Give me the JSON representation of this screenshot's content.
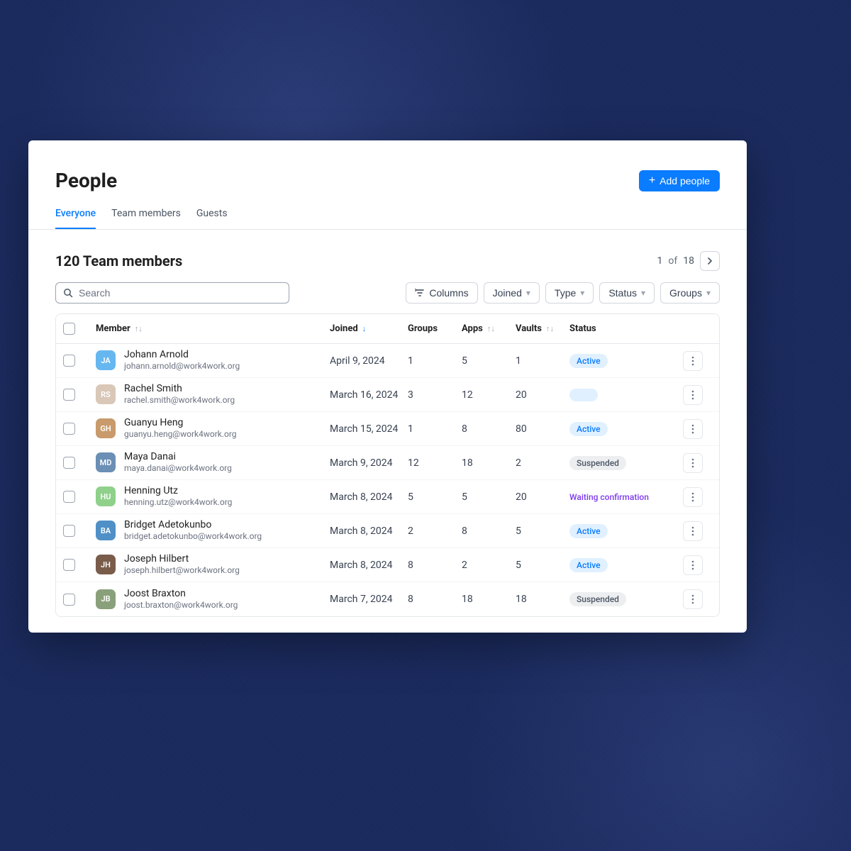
{
  "header": {
    "title": "People",
    "add_button": "Add people"
  },
  "tabs": [
    {
      "label": "Everyone",
      "active": true
    },
    {
      "label": "Team members",
      "active": false
    },
    {
      "label": "Guests",
      "active": false
    }
  ],
  "subhead": {
    "count_label": "120 Team members"
  },
  "pagination": {
    "current": "1",
    "of": "of",
    "total": "18"
  },
  "search": {
    "placeholder": "Search"
  },
  "filters": {
    "columns": "Columns",
    "joined": "Joined",
    "type": "Type",
    "status": "Status",
    "groups": "Groups"
  },
  "columns": {
    "member": "Member",
    "joined": "Joined",
    "groups": "Groups",
    "apps": "Apps",
    "vaults": "Vaults",
    "status": "Status"
  },
  "members": [
    {
      "initials": "JA",
      "avatar_bg": "#66b7f0",
      "name": "Johann Arnold",
      "email": "johann.arnold@work4work.org",
      "joined": "April 9, 2024",
      "groups": "1",
      "apps": "5",
      "vaults": "1",
      "status": "Active",
      "status_kind": "active"
    },
    {
      "initials": "RS",
      "avatar_bg": "#d9c7b8",
      "name": "Rachel Smith",
      "email": "rachel.smith@work4work.org",
      "joined": "March 16, 2024",
      "groups": "3",
      "apps": "12",
      "vaults": "20",
      "status": "",
      "status_kind": "empty"
    },
    {
      "initials": "GH",
      "avatar_bg": "#c99a6b",
      "name": "Guanyu Heng",
      "email": "guanyu.heng@work4work.org",
      "joined": "March 15, 2024",
      "groups": "1",
      "apps": "8",
      "vaults": "80",
      "status": "Active",
      "status_kind": "active"
    },
    {
      "initials": "MD",
      "avatar_bg": "#6b8fb5",
      "name": "Maya Danai",
      "email": "maya.danai@work4work.org",
      "joined": "March 9, 2024",
      "groups": "12",
      "apps": "18",
      "vaults": "2",
      "status": "Suspended",
      "status_kind": "suspended"
    },
    {
      "initials": "HU",
      "avatar_bg": "#8fd08a",
      "name": "Henning Utz",
      "email": "henning.utz@work4work.org",
      "joined": "March 8, 2024",
      "groups": "5",
      "apps": "5",
      "vaults": "20",
      "status": "Waiting confirmation",
      "status_kind": "waiting"
    },
    {
      "initials": "BA",
      "avatar_bg": "#4f90c7",
      "name": "Bridget Adetokunbo",
      "email": "bridget.adetokunbo@work4work.org",
      "joined": "March 8, 2024",
      "groups": "2",
      "apps": "8",
      "vaults": "5",
      "status": "Active",
      "status_kind": "active"
    },
    {
      "initials": "JH",
      "avatar_bg": "#7a5c4a",
      "name": "Joseph Hilbert",
      "email": "joseph.hilbert@work4work.org",
      "joined": "March 8, 2024",
      "groups": "8",
      "apps": "2",
      "vaults": "5",
      "status": "Active",
      "status_kind": "active"
    },
    {
      "initials": "JB",
      "avatar_bg": "#8aa07a",
      "name": "Joost Braxton",
      "email": "joost.braxton@work4work.org",
      "joined": "March 7, 2024",
      "groups": "8",
      "apps": "18",
      "vaults": "18",
      "status": "Suspended",
      "status_kind": "suspended"
    }
  ]
}
